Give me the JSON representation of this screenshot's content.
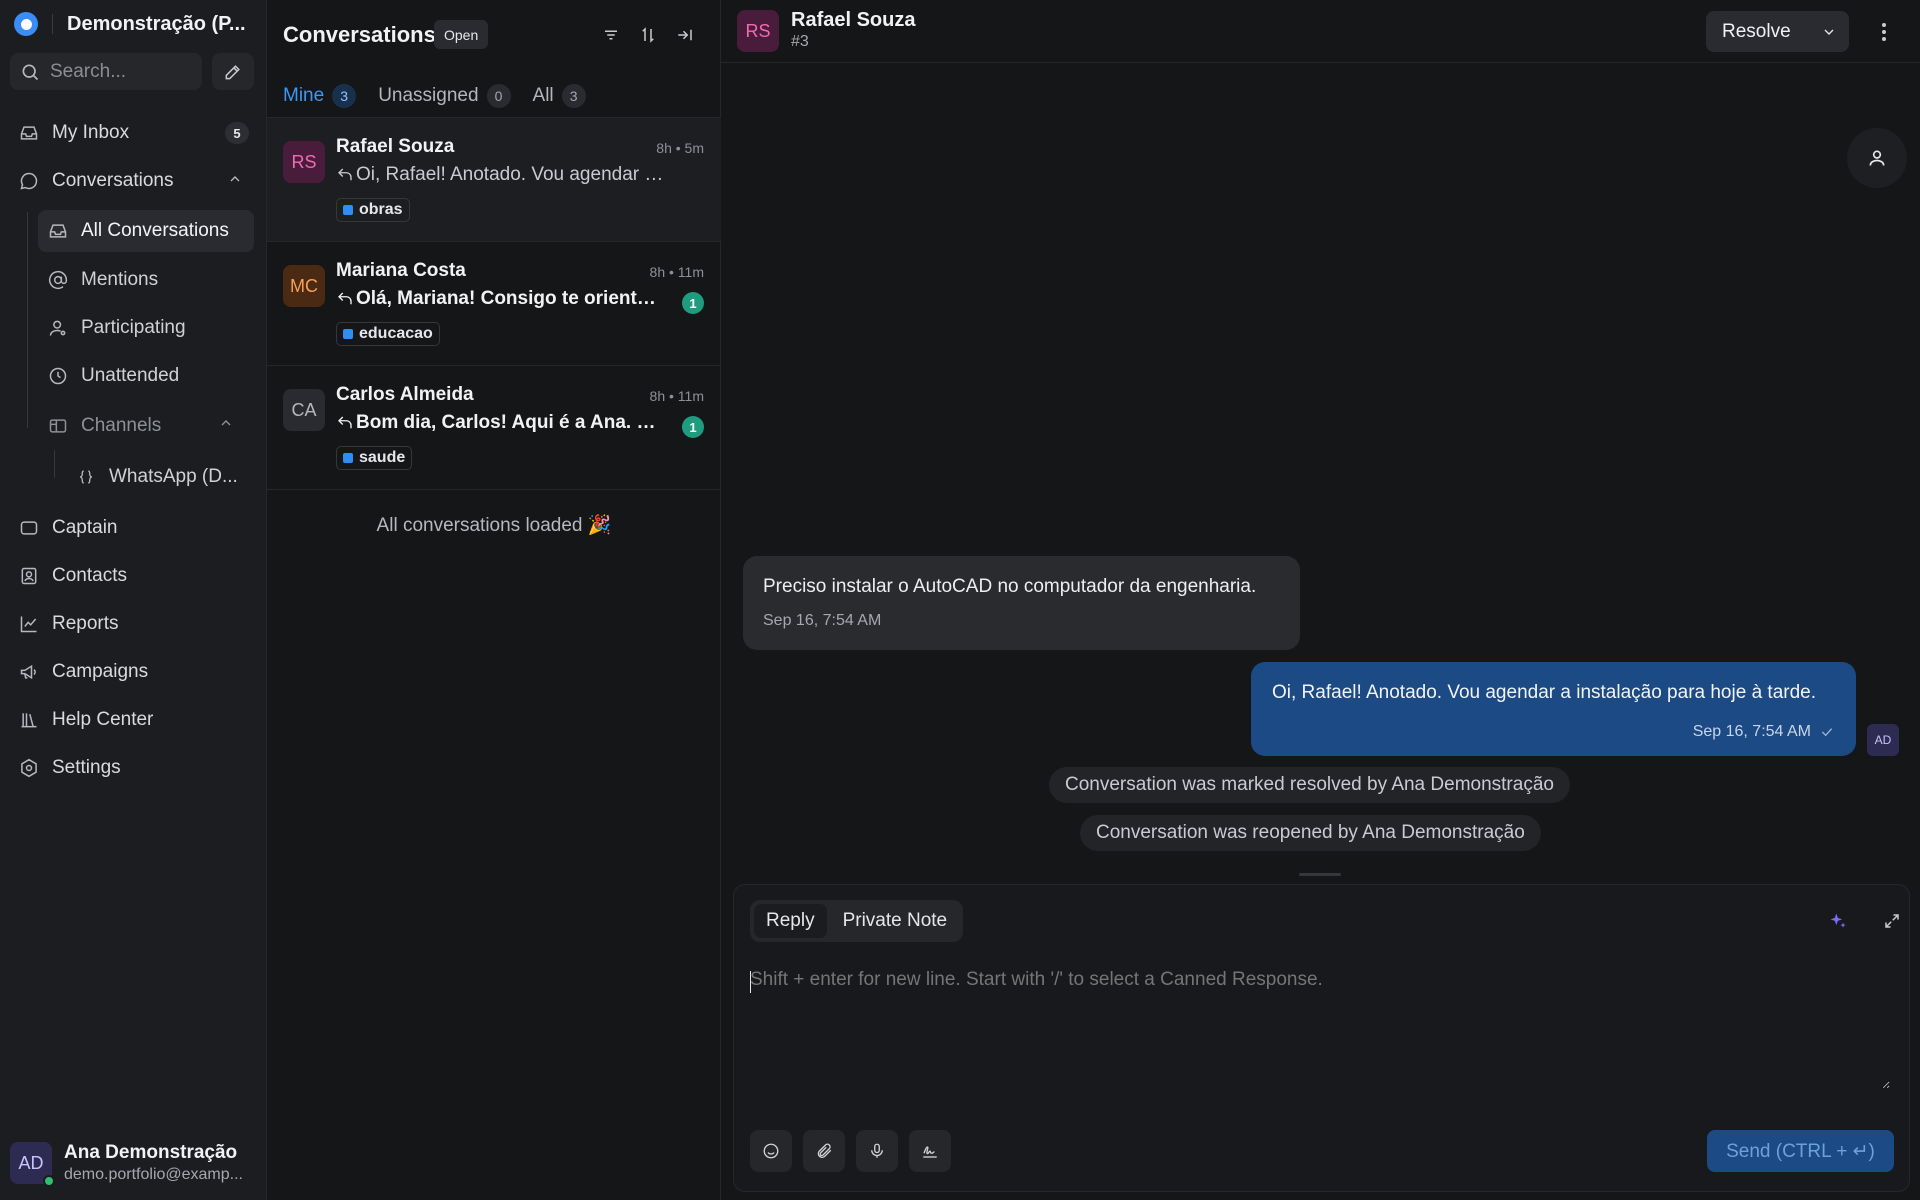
{
  "workspace": {
    "name": "Demonstração (P..."
  },
  "search": {
    "placeholder": "Search..."
  },
  "nav": {
    "my_inbox": {
      "label": "My Inbox",
      "count": "5"
    },
    "conversations": {
      "label": "Conversations"
    },
    "sub": {
      "all": "All Conversations",
      "mentions": "Mentions",
      "participating": "Participating",
      "unattended": "Unattended",
      "channels": "Channels",
      "whatsapp": "WhatsApp (D..."
    },
    "captain": "Captain",
    "contacts": "Contacts",
    "reports": "Reports",
    "campaigns": "Campaigns",
    "help_center": "Help Center",
    "settings": "Settings"
  },
  "profile": {
    "initials": "AD",
    "name": "Ana Demonstração",
    "email": "demo.portfolio@examp..."
  },
  "list": {
    "title": "Conversations",
    "status": "Open",
    "tabs": [
      {
        "label": "Mine",
        "count": "3"
      },
      {
        "label": "Unassigned",
        "count": "0"
      },
      {
        "label": "All",
        "count": "3"
      }
    ],
    "items": [
      {
        "initials": "RS",
        "name": "Rafael Souza",
        "time": "8h • 5m",
        "message": "Oi, Rafael! Anotado. Vou agendar a i...",
        "label": "obras",
        "unread": ""
      },
      {
        "initials": "MC",
        "name": "Mariana Costa",
        "time": "8h • 11m",
        "message": "Olá, Mariana! Consigo te orientar...",
        "label": "educacao",
        "unread": "1"
      },
      {
        "initials": "CA",
        "name": "Carlos Almeida",
        "time": "8h • 11m",
        "message": "Bom dia, Carlos! Aqui é a Ana. Vo...",
        "label": "saude",
        "unread": "1"
      }
    ],
    "footer": "All conversations loaded 🎉"
  },
  "chat": {
    "contact_initials": "RS",
    "contact_name": "Rafael Souza",
    "conversation_id": "#3",
    "resolve_label": "Resolve",
    "messages": {
      "incoming": {
        "text": "Preciso instalar o AutoCAD no computador da engenharia.",
        "time": "Sep 16, 7:54 AM"
      },
      "outgoing": {
        "text": "Oi, Rafael! Anotado. Vou agendar a instalação para hoje à tarde.",
        "time": "Sep 16, 7:54 AM",
        "agent_initials": "AD"
      }
    },
    "activity": [
      "Conversation was marked resolved by Ana Demonstração",
      "Conversation was reopened by Ana Demonstração"
    ]
  },
  "composer": {
    "reply_tab": "Reply",
    "note_tab": "Private Note",
    "placeholder": "Shift + enter for new line. Start with '/' to select a Canned Response.",
    "send_label": "Send (CTRL + ↵)"
  },
  "colors": {
    "accent": "#3f97f5",
    "outgoing_bubble": "#1c4a84",
    "unread_badge": "#1f9c7f",
    "label_dot": "#2e8ef3"
  }
}
